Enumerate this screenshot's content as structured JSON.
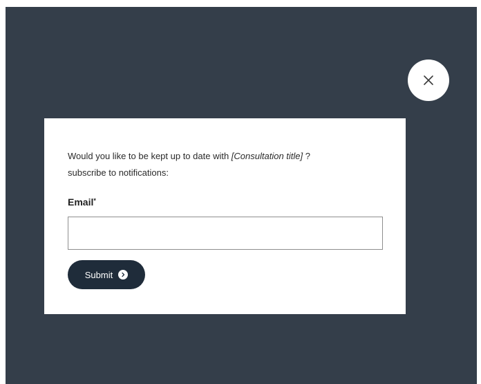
{
  "modal": {
    "message_before": "Would you like to be kept up to date with ",
    "consultation_title": "[Consultation title]",
    "message_after": " ?",
    "message_line2": "subscribe to notifications:",
    "email_label": "Email",
    "required_marker": "*",
    "email_value": "",
    "email_placeholder": "",
    "submit_label": "Submit"
  },
  "icons": {
    "close": "close-icon",
    "submit_chevron": "chevron-right-icon"
  },
  "colors": {
    "overlay": "#343e4a",
    "modal_background": "#ffffff",
    "button_background": "#1f2c3a",
    "button_text": "#ffffff"
  }
}
